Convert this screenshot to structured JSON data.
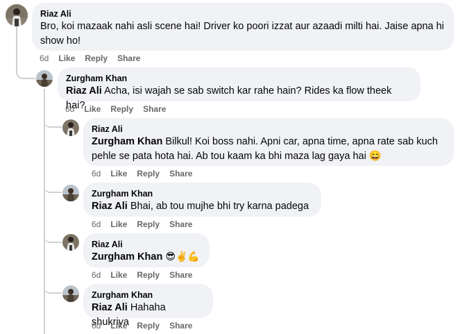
{
  "comments": [
    {
      "author": "Riaz Ali",
      "mention": "",
      "text": "Bro, koi mazaak nahi asli scene hai! Driver ko poori izzat aur azaadi milti hai. Jaise apna hi show ho!",
      "time": "6d",
      "like": "Like",
      "reply": "Reply",
      "share": "Share"
    },
    {
      "author": "Zurgham Khan",
      "mention": "Riaz Ali",
      "text": "Acha, isi wajah se sab switch kar rahe hain? Rides ka flow theek hai?",
      "time": "6d",
      "like": "Like",
      "reply": "Reply",
      "share": "Share"
    },
    {
      "author": "Riaz Ali",
      "mention": "Zurgham Khan",
      "text": "Bilkul! Koi boss nahi. Apni car, apna time, apna rate sab kuch pehle se pata hota hai. Ab tou kaam ka bhi maza lag gaya hai 😄",
      "time": "6d",
      "like": "Like",
      "reply": "Reply",
      "share": "Share"
    },
    {
      "author": "Zurgham Khan",
      "mention": "Riaz Ali",
      "text": "Bhai, ab tou mujhe bhi try karna padega",
      "time": "6d",
      "like": "Like",
      "reply": "Reply",
      "share": "Share"
    },
    {
      "author": "Riaz Ali",
      "mention": "Zurgham Khan",
      "text": "😎✌️💪",
      "time": "6d",
      "like": "Like",
      "reply": "Reply",
      "share": "Share"
    },
    {
      "author": "Zurgham Khan",
      "mention": "Riaz Ali",
      "text": "Hahaha shukriya",
      "time": "6d",
      "like": "Like",
      "reply": "Reply",
      "share": "Share"
    }
  ]
}
